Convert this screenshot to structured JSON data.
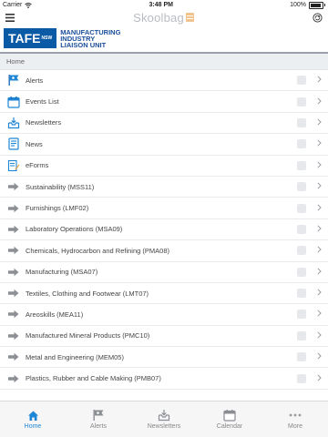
{
  "status": {
    "carrier": "Carrier",
    "time": "3:48 PM",
    "battery": "100%"
  },
  "topbar": {
    "brand": "Skoolbag"
  },
  "header": {
    "logo": "TAFE",
    "logo_sub": "NSW",
    "unit_line1": "Manufacturing",
    "unit_line2": "Industry",
    "unit_line3": "Liaison Unit"
  },
  "breadcrumb": "Home",
  "colors": {
    "accent": "#1e86d6",
    "tafe_blue": "#0a5aa5"
  },
  "items": [
    {
      "label": "Alerts",
      "icon": "flag-icon"
    },
    {
      "label": "Events List",
      "icon": "calendar-icon"
    },
    {
      "label": "Newsletters",
      "icon": "newsletter-icon"
    },
    {
      "label": "News",
      "icon": "news-icon"
    },
    {
      "label": "eForms",
      "icon": "eforms-icon"
    },
    {
      "label": "Sustainability (MSS11)",
      "icon": "arrow-right-icon"
    },
    {
      "label": "Furnishings (LMF02)",
      "icon": "arrow-right-icon"
    },
    {
      "label": "Laboratory Operations (MSA09)",
      "icon": "arrow-right-icon"
    },
    {
      "label": "Chemicals, Hydrocarbon and Refining (PMA08)",
      "icon": "arrow-right-icon"
    },
    {
      "label": "Manufacturing (MSA07)",
      "icon": "arrow-right-icon"
    },
    {
      "label": "Textiles, Clothing and Footwear (LMT07)",
      "icon": "arrow-right-icon"
    },
    {
      "label": "Areoskills (MEA11)",
      "icon": "arrow-right-icon"
    },
    {
      "label": "Manufactured Mineral Products (PMC10)",
      "icon": "arrow-right-icon"
    },
    {
      "label": "Metal and Engineering (MEM05)",
      "icon": "arrow-right-icon"
    },
    {
      "label": "Plastics, Rubber and Cable Making (PMB07)",
      "icon": "arrow-right-icon"
    }
  ],
  "tabs": [
    {
      "label": "Home",
      "icon": "home-icon",
      "active": true
    },
    {
      "label": "Alerts",
      "icon": "flag-icon",
      "active": false
    },
    {
      "label": "Newsletters",
      "icon": "newsletter-icon",
      "active": false
    },
    {
      "label": "Calendar",
      "icon": "calendar-icon",
      "active": false
    },
    {
      "label": "More",
      "icon": "more-icon",
      "active": false
    }
  ]
}
